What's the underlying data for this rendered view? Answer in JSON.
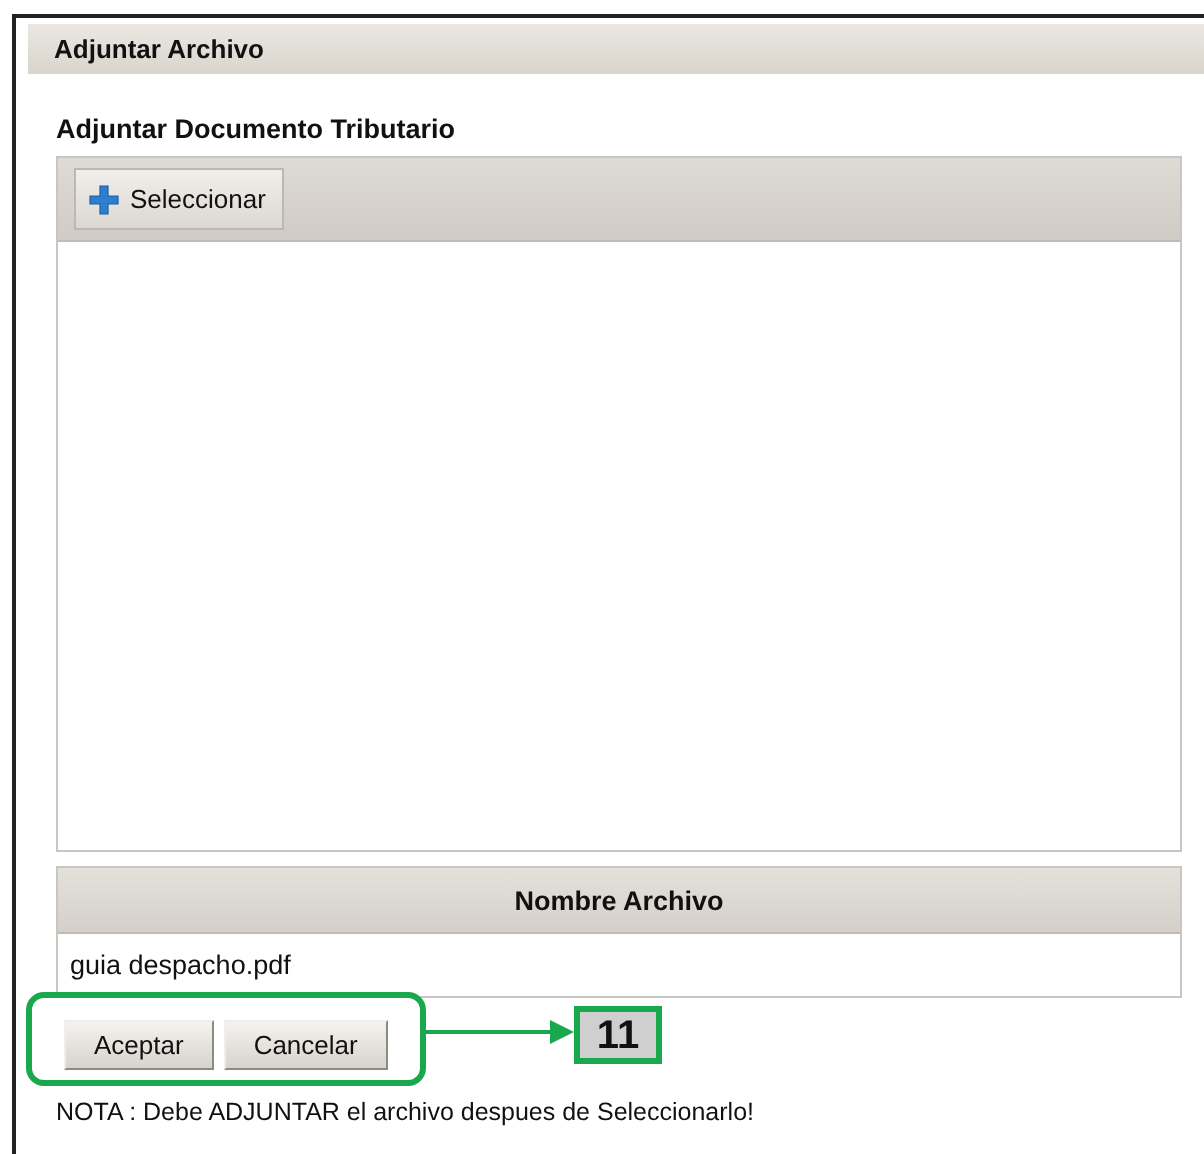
{
  "panel": {
    "title": "Adjuntar Archivo"
  },
  "section_title": "Adjuntar Documento Tributario",
  "uploader": {
    "select_button": "Seleccionar"
  },
  "files_table": {
    "columns": [
      "Nombre Archivo"
    ],
    "rows": [
      [
        "guia despacho.pdf"
      ]
    ]
  },
  "buttons": [
    "Aceptar",
    "Cancelar"
  ],
  "annotation": {
    "label": "11"
  },
  "note": "NOTA : Debe ADJUNTAR el archivo despues de Seleccionarlo!"
}
